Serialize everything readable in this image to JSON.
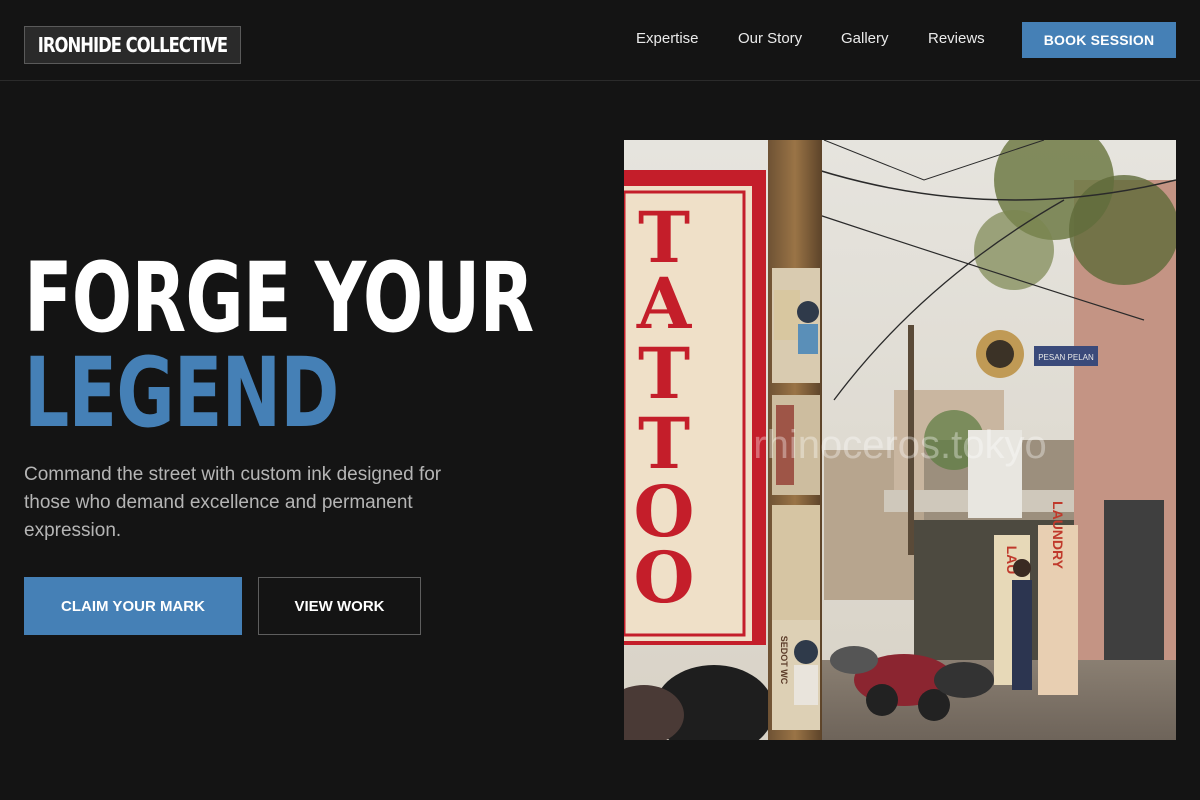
{
  "header": {
    "logo": "IRONHIDE COLLECTIVE",
    "nav": [
      "Expertise",
      "Our Story",
      "Gallery",
      "Reviews"
    ],
    "cta": "BOOK SESSION"
  },
  "hero": {
    "headline_line1": "FORGE YOUR",
    "headline_line2": "LEGEND",
    "subtitle": "Command the street with custom ink designed for those who demand excellence and permanent expression.",
    "primary_button": "CLAIM YOUR MARK",
    "secondary_button": "VIEW WORK"
  },
  "photo": {
    "sign_letters": [
      "T",
      "A",
      "T",
      "T",
      "O",
      "O"
    ],
    "laundry_sign": "LAUNDRY",
    "laundry_sign_left": "LAU",
    "small_sign": "PESAN PELAN",
    "watermark": "rhinoceros.tokyo",
    "pole_text": "SEDOT WC"
  },
  "colors": {
    "background": "#141414",
    "accent": "#4580b6",
    "text": "#ffffff",
    "muted": "#b5b5b5"
  }
}
